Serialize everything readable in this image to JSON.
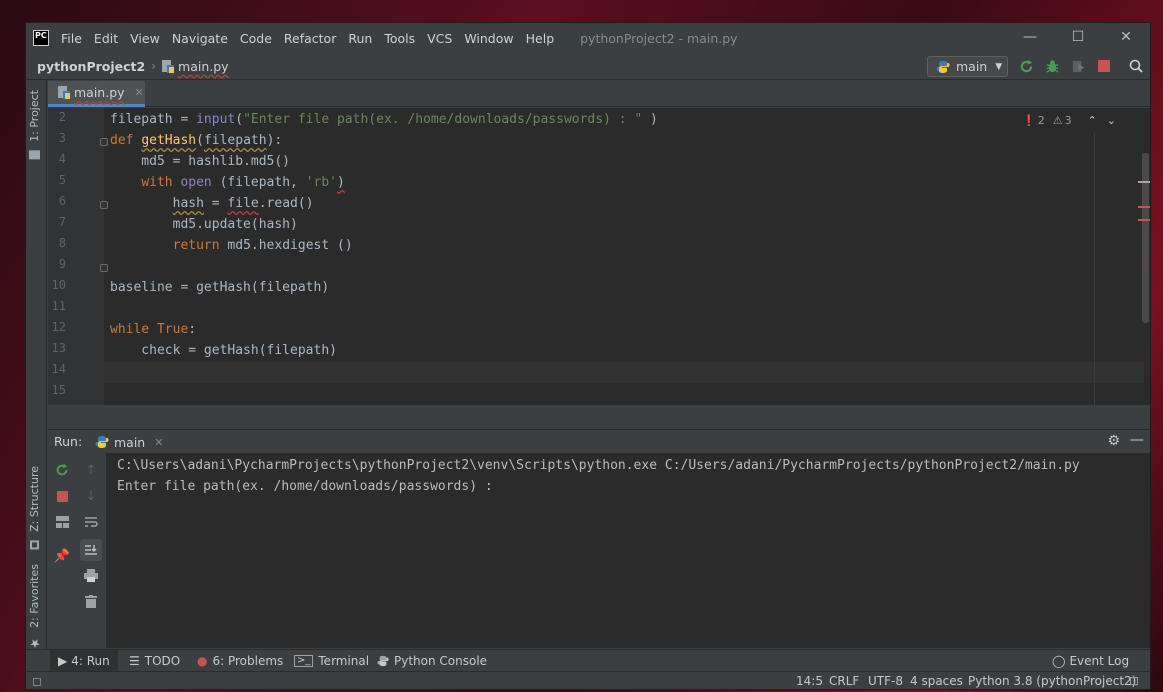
{
  "window": {
    "app_logo": "PC",
    "title": "pythonProject2 - main.py",
    "menu": [
      "File",
      "Edit",
      "View",
      "Navigate",
      "Code",
      "Refactor",
      "Run",
      "Tools",
      "VCS",
      "Window",
      "Help"
    ]
  },
  "navbar": {
    "project": "pythonProject2",
    "file": "main.py",
    "run_config": "main"
  },
  "left_strip": {
    "project_tab": "1: Project",
    "structure_tab": "Z: Structure",
    "favorites_tab": "2: Favorites"
  },
  "editor": {
    "tab_label": "main.py",
    "errors": "2",
    "warnings": "3",
    "line_numbers": [
      "2",
      "3",
      "4",
      "5",
      "6",
      "7",
      "8",
      "9",
      "10",
      "11",
      "12",
      "13",
      "14",
      "15"
    ],
    "lines": {
      "l2_a": "filepath = ",
      "l2_b": "input",
      "l2_c": "(",
      "l2_d": "\"Enter file path(ex. /home/downloads/passwords) : \"",
      "l2_e": " )",
      "l3_a": "def ",
      "l3_b": "getHash",
      "l3_c": "(",
      "l3_d": "filepath",
      "l3_e": "):",
      "l4": "    md5 = hashlib.md5()",
      "l5_a": "    ",
      "l5_b": "with ",
      "l5_c": "open",
      "l5_d": " (filepath, ",
      "l5_e": "'rb'",
      "l5_f": ")",
      "l6_a": "        ",
      "l6_b": "hash",
      "l6_c": " = ",
      "l6_d": "file",
      "l6_e": ".read()",
      "l7": "        md5.update(hash)",
      "l8_a": "        ",
      "l8_b": "return ",
      "l8_c": "md5.hexdigest ()",
      "l10": "baseline = getHash(filepath)",
      "l12_a": "while ",
      "l12_b": "True",
      "l12_c": ":",
      "l13": "    check = getHash(filepath)"
    }
  },
  "run_panel": {
    "label": "Run:",
    "tab": "main",
    "console": [
      "C:\\Users\\adani\\PycharmProjects\\pythonProject2\\venv\\Scripts\\python.exe C:/Users/adani/PycharmProjects/pythonProject2/main.py",
      "Enter file path(ex. /home/downloads/passwords) : "
    ]
  },
  "tool_tabs": {
    "run": "4: Run",
    "todo": "TODO",
    "problems": "6: Problems",
    "terminal": "Terminal",
    "python_console": "Python Console",
    "event_log": "Event Log"
  },
  "status_bar": {
    "position": "14:5",
    "line_sep": "CRLF",
    "encoding": "UTF-8",
    "indent": "4 spaces",
    "interpreter": "Python 3.8 (pythonProject2)"
  },
  "colors": {
    "accent": "#4a88c7",
    "run_green": "#499c54",
    "stop_red": "#c75450",
    "error": "#c75450"
  }
}
